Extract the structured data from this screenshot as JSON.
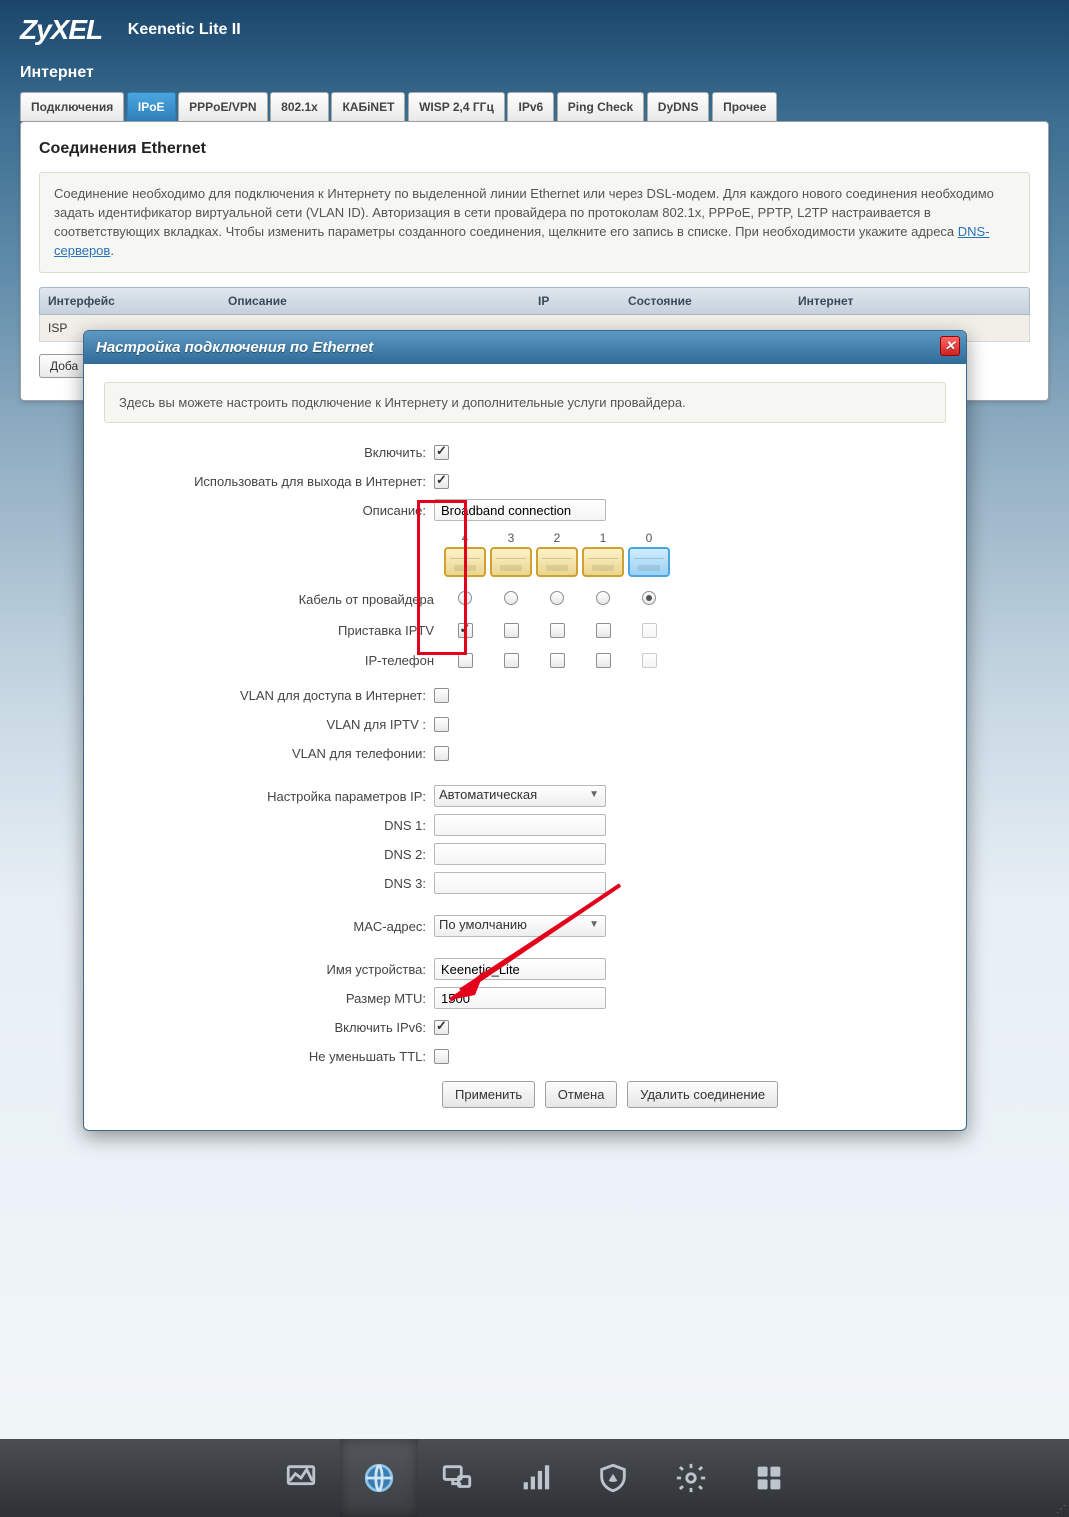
{
  "header": {
    "logo": "ZyXEL",
    "product": "Keenetic Lite II"
  },
  "breadcrumb": "Интернет",
  "tabs": [
    {
      "id": "conn",
      "label": "Подключения",
      "active": false
    },
    {
      "id": "ipoe",
      "label": "IPoE",
      "active": true
    },
    {
      "id": "pppoe",
      "label": "PPPoE/VPN",
      "active": false
    },
    {
      "id": "8021x",
      "label": "802.1x",
      "active": false
    },
    {
      "id": "kabinet",
      "label": "КАБiNET",
      "active": false
    },
    {
      "id": "wisp",
      "label": "WISP 2,4 ГГц",
      "active": false
    },
    {
      "id": "ipv6",
      "label": "IPv6",
      "active": false
    },
    {
      "id": "ping",
      "label": "Ping Check",
      "active": false
    },
    {
      "id": "dydns",
      "label": "DyDNS",
      "active": false
    },
    {
      "id": "other",
      "label": "Прочее",
      "active": false
    }
  ],
  "panel": {
    "title": "Соединения Ethernet",
    "info_pre": "Соединение необходимо для подключения к Интернету по выделенной линии Ethernet или через DSL-модем. Для каждого нового соединения необходимо задать идентификатор виртуальной сети (VLAN ID). Авторизация в сети провайдера по протоколам 802.1x, PPPoE, PPTP, L2TP настраивается в соответствующих вкладках. Чтобы изменить параметры созданного соединения, щелкните его запись в списке. При необходимости укажите адреса ",
    "dns_link": "DNS-серверов",
    "info_post": ".",
    "columns": {
      "interface": "Интерфейс",
      "desc": "Описание",
      "ip": "IP",
      "state": "Состояние",
      "net": "Интернет"
    },
    "row": {
      "interface": "ISP"
    },
    "add_button": "Доба"
  },
  "modal": {
    "title": "Настройка подключения по Ethernet",
    "info": "Здесь вы можете настроить подключение к Интернету и дополнительные услуги провайдера.",
    "labels": {
      "enable": "Включить:",
      "use_internet": "Использовать для выхода в Интернет:",
      "description": "Описание:",
      "provider_cable": "Кабель от провайдера",
      "iptv_box": "Приставка IPTV",
      "ip_phone": "IP-телефон",
      "vlan_internet": "VLAN для доступа в Интернет:",
      "vlan_iptv": "VLAN для IPTV :",
      "vlan_phone": "VLAN для телефонии:",
      "ip_params": "Настройка параметров IP:",
      "dns1": "DNS 1:",
      "dns2": "DNS 2:",
      "dns3": "DNS 3:",
      "mac": "MAC-адрес:",
      "device_name": "Имя устройства:",
      "mtu": "Размер MTU:",
      "enable_ipv6": "Включить IPv6:",
      "no_decrease_ttl": "Не уменьшать TTL:"
    },
    "values": {
      "enable": true,
      "use_internet": true,
      "description": "Broadband connection",
      "ip_params": "Автоматическая",
      "dns1": "",
      "dns2": "",
      "dns3": "",
      "mac": "По умолчанию",
      "device_name": "Keenetic_Lite",
      "mtu": "1500",
      "enable_ipv6": true,
      "no_decrease_ttl": false,
      "vlan_internet": false,
      "vlan_iptv": false,
      "vlan_phone": false
    },
    "ports": {
      "numbers": [
        "4",
        "3",
        "2",
        "1",
        "0"
      ],
      "provider_cable": [
        false,
        false,
        false,
        false,
        true
      ],
      "iptv_box": [
        true,
        false,
        false,
        false,
        false
      ],
      "ip_phone": [
        false,
        false,
        false,
        false,
        false
      ]
    },
    "buttons": {
      "apply": "Применить",
      "cancel": "Отмена",
      "delete": "Удалить соединение"
    }
  },
  "dock_icons": [
    "monitor",
    "globe",
    "network",
    "signal",
    "shield",
    "gear",
    "apps"
  ]
}
